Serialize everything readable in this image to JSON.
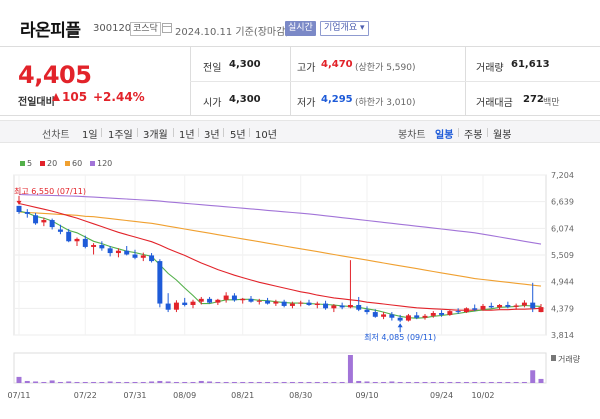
{
  "header": {
    "name": "라온피플",
    "code": "300120",
    "market": "코스닥",
    "date": "2024.10.11 기준(장마감)",
    "realtime": "실시간",
    "overview": "기업개요 ▾"
  },
  "quote": {
    "price": "4,405",
    "prev_label": "전일대비",
    "change": "105",
    "change_pct": "+2.44%",
    "prev_close_label": "전일",
    "prev_close": "4,300",
    "open_label": "시가",
    "open": "4,300",
    "high_label": "고가",
    "high": "4,470",
    "upper_limit": "(상한가 5,590)",
    "low_label": "저가",
    "low": "4,295",
    "lower_limit": "(하한가 3,010)",
    "volume_label": "거래량",
    "volume": "61,613",
    "amount_label": "거래대금",
    "amount": "272",
    "amount_unit": "백만"
  },
  "toolbar": {
    "line_chart": "선차트",
    "periods": [
      "1일",
      "1주일",
      "3개월",
      "1년",
      "3년",
      "5년",
      "10년"
    ],
    "candle_chart": "봉차트",
    "candle_periods": [
      "일봉",
      "주봉",
      "월봉"
    ]
  },
  "colors": {
    "rise": "#e2232a",
    "fall": "#1e5bd8",
    "ma5": "#53b04a",
    "ma20": "#e2232a",
    "ma60": "#f0a030",
    "ma120": "#a274d8",
    "volume": "#a274d8"
  },
  "chart_data": {
    "type": "candlestick",
    "legend": [
      "5",
      "20",
      "60",
      "120"
    ],
    "y_ticks": [
      "7,204",
      "6,639",
      "6,074",
      "5,509",
      "4,944",
      "4,379",
      "3,814"
    ],
    "ylim": [
      3814,
      7204
    ],
    "x_ticks": [
      "07/11",
      "07/22",
      "07/31",
      "08/09",
      "08/21",
      "08/30",
      "09/10",
      "09/24",
      "10/02"
    ],
    "high_annotation": "최고 6,550 (07/11)",
    "low_annotation": "최저 4,085 (09/11)",
    "volume_label": "거래량",
    "candles": [
      [
        6550,
        6550,
        6380,
        6420
      ],
      [
        6420,
        6480,
        6300,
        6380
      ],
      [
        6350,
        6400,
        6150,
        6180
      ],
      [
        6200,
        6300,
        6120,
        6250
      ],
      [
        6250,
        6280,
        6050,
        6100
      ],
      [
        6050,
        6150,
        5950,
        6000
      ],
      [
        6000,
        6060,
        5780,
        5800
      ],
      [
        5800,
        5880,
        5700,
        5850
      ],
      [
        5850,
        5920,
        5650,
        5680
      ],
      [
        5680,
        5760,
        5520,
        5720
      ],
      [
        5720,
        5800,
        5600,
        5650
      ],
      [
        5650,
        5700,
        5480,
        5550
      ],
      [
        5550,
        5650,
        5460,
        5600
      ],
      [
        5600,
        5700,
        5500,
        5520
      ],
      [
        5520,
        5620,
        5420,
        5450
      ],
      [
        5450,
        5560,
        5380,
        5500
      ],
      [
        5500,
        5550,
        5350,
        5380
      ],
      [
        5380,
        5420,
        4400,
        4480
      ],
      [
        4480,
        4700,
        4300,
        4350
      ],
      [
        4350,
        4550,
        4300,
        4500
      ],
      [
        4500,
        4600,
        4420,
        4450
      ],
      [
        4450,
        4560,
        4380,
        4520
      ],
      [
        4520,
        4620,
        4460,
        4580
      ],
      [
        4580,
        4620,
        4480,
        4500
      ],
      [
        4500,
        4580,
        4450,
        4560
      ],
      [
        4560,
        4720,
        4500,
        4650
      ],
      [
        4650,
        4700,
        4520,
        4550
      ],
      [
        4550,
        4600,
        4480,
        4580
      ],
      [
        4580,
        4640,
        4500,
        4520
      ],
      [
        4520,
        4580,
        4460,
        4540
      ],
      [
        4540,
        4600,
        4460,
        4480
      ],
      [
        4480,
        4560,
        4430,
        4520
      ],
      [
        4520,
        4560,
        4400,
        4430
      ],
      [
        4430,
        4520,
        4380,
        4480
      ],
      [
        4480,
        4540,
        4420,
        4500
      ],
      [
        4500,
        4560,
        4430,
        4450
      ],
      [
        4450,
        4520,
        4380,
        4480
      ],
      [
        4480,
        4540,
        4350,
        4380
      ],
      [
        4380,
        4470,
        4300,
        4440
      ],
      [
        4440,
        4500,
        4360,
        4400
      ],
      [
        4400,
        5400,
        4380,
        4450
      ],
      [
        4450,
        4620,
        4320,
        4350
      ],
      [
        4350,
        4420,
        4250,
        4300
      ],
      [
        4300,
        4360,
        4180,
        4200
      ],
      [
        4200,
        4300,
        4150,
        4250
      ],
      [
        4250,
        4300,
        4120,
        4180
      ],
      [
        4180,
        4240,
        4085,
        4120
      ],
      [
        4120,
        4260,
        4100,
        4230
      ],
      [
        4230,
        4300,
        4150,
        4180
      ],
      [
        4180,
        4260,
        4140,
        4220
      ],
      [
        4220,
        4320,
        4180,
        4280
      ],
      [
        4280,
        4340,
        4200,
        4240
      ],
      [
        4240,
        4350,
        4220,
        4320
      ],
      [
        4320,
        4380,
        4260,
        4300
      ],
      [
        4300,
        4400,
        4280,
        4380
      ],
      [
        4380,
        4460,
        4320,
        4350
      ],
      [
        4350,
        4470,
        4330,
        4430
      ],
      [
        4430,
        4500,
        4380,
        4400
      ],
      [
        4400,
        4470,
        4360,
        4450
      ],
      [
        4450,
        4520,
        4380,
        4410
      ],
      [
        4410,
        4480,
        4350,
        4440
      ],
      [
        4440,
        4550,
        4400,
        4500
      ],
      [
        4500,
        4920,
        4300,
        4380
      ],
      [
        4300,
        4470,
        4295,
        4405
      ]
    ],
    "ma5": [
      6440,
      6400,
      6330,
      6290,
      6230,
      6130,
      6030,
      5980,
      5890,
      5800,
      5750,
      5690,
      5640,
      5590,
      5560,
      5520,
      5480,
      5300,
      5120,
      4980,
      4810,
      4650,
      4480,
      4480,
      4520,
      4560,
      4560,
      4570,
      4570,
      4550,
      4540,
      4520,
      4500,
      4490,
      4490,
      4480,
      4470,
      4460,
      4450,
      4430,
      4420,
      4400,
      4370,
      4340,
      4300,
      4250,
      4210,
      4180,
      4170,
      4180,
      4210,
      4230,
      4250,
      4270,
      4300,
      4320,
      4350,
      4370,
      4400,
      4410,
      4420,
      4440,
      4430,
      4420
    ],
    "ma20": [
      6600,
      6560,
      6520,
      6480,
      6440,
      6390,
      6340,
      6290,
      6230,
      6170,
      6110,
      6050,
      5990,
      5940,
      5890,
      5840,
      5790,
      5720,
      5640,
      5570,
      5500,
      5420,
      5340,
      5270,
      5200,
      5140,
      5080,
      5030,
      4980,
      4930,
      4890,
      4850,
      4810,
      4770,
      4730,
      4700,
      4660,
      4630,
      4600,
      4580,
      4560,
      4540,
      4510,
      4490,
      4470,
      4450,
      4430,
      4410,
      4390,
      4380,
      4370,
      4360,
      4350,
      4340,
      4340,
      4340,
      4340,
      4340,
      4350,
      4350,
      4360,
      4360,
      4370,
      4380
    ],
    "ma60": [
      6420,
      6410,
      6400,
      6390,
      6380,
      6370,
      6360,
      6350,
      6330,
      6320,
      6300,
      6280,
      6260,
      6240,
      6220,
      6200,
      6180,
      6150,
      6120,
      6090,
      6060,
      6030,
      6000,
      5970,
      5940,
      5910,
      5880,
      5850,
      5820,
      5790,
      5760,
      5730,
      5700,
      5670,
      5640,
      5610,
      5580,
      5550,
      5520,
      5490,
      5460,
      5430,
      5400,
      5370,
      5340,
      5310,
      5280,
      5250,
      5220,
      5190,
      5160,
      5130,
      5100,
      5070,
      5040,
      5010,
      4990,
      4970,
      4950,
      4930,
      4910,
      4890,
      4870,
      4850
    ],
    "ma120": [
      6790,
      6785,
      6780,
      6775,
      6770,
      6765,
      6760,
      6755,
      6745,
      6735,
      6725,
      6715,
      6705,
      6695,
      6685,
      6675,
      6665,
      6650,
      6635,
      6620,
      6605,
      6590,
      6575,
      6560,
      6545,
      6530,
      6515,
      6500,
      6485,
      6470,
      6455,
      6440,
      6425,
      6410,
      6395,
      6380,
      6360,
      6340,
      6320,
      6300,
      6280,
      6260,
      6240,
      6220,
      6200,
      6180,
      6160,
      6140,
      6120,
      6100,
      6080,
      6060,
      6040,
      6020,
      6000,
      5980,
      5950,
      5920,
      5890,
      5860,
      5830,
      5800,
      5770,
      5740
    ],
    "volume": [
      12,
      4,
      3,
      2,
      5,
      2,
      3,
      2,
      2,
      2,
      2,
      3,
      2,
      2,
      2,
      2,
      3,
      4,
      3,
      2,
      2,
      2,
      4,
      3,
      2,
      2,
      2,
      2,
      2,
      2,
      2,
      2,
      2,
      2,
      2,
      2,
      2,
      2,
      2,
      2,
      55,
      4,
      3,
      2,
      2,
      3,
      2,
      2,
      2,
      2,
      2,
      2,
      2,
      2,
      2,
      2,
      2,
      2,
      2,
      2,
      2,
      2,
      25,
      8
    ]
  }
}
